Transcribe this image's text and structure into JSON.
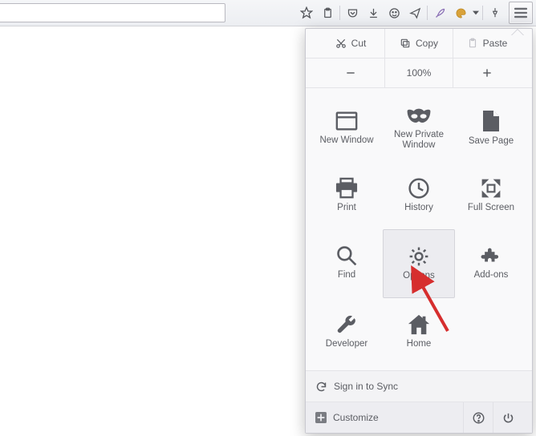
{
  "toolbar": {
    "url_value": ""
  },
  "menu": {
    "edit": {
      "cut": "Cut",
      "copy": "Copy",
      "paste": "Paste"
    },
    "zoom": {
      "level": "100%"
    },
    "items": [
      {
        "label": "New Window"
      },
      {
        "label": "New Private Window"
      },
      {
        "label": "Save Page"
      },
      {
        "label": "Print"
      },
      {
        "label": "History"
      },
      {
        "label": "Full Screen"
      },
      {
        "label": "Find"
      },
      {
        "label": "Options"
      },
      {
        "label": "Add-ons"
      },
      {
        "label": "Developer"
      },
      {
        "label": "Home"
      }
    ],
    "sync": "Sign in to Sync",
    "customize": "Customize"
  },
  "colors": {
    "icon": "#5b5d63",
    "arrow": "#d62e2e"
  }
}
